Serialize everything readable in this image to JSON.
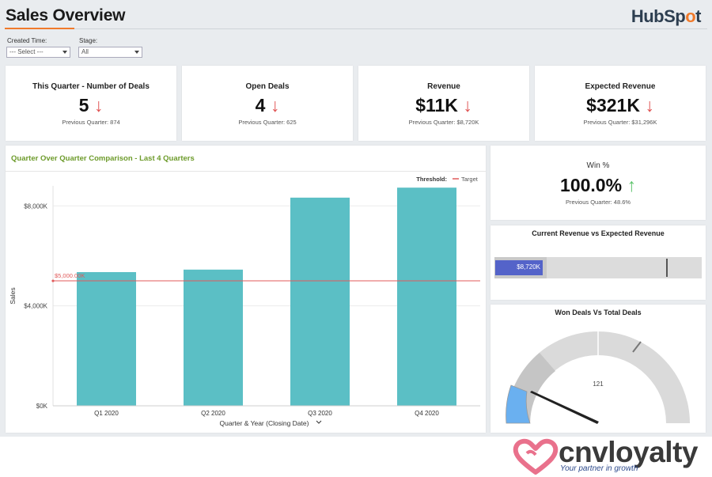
{
  "header": {
    "title": "Sales Overview",
    "brand_logo": "HubSpot",
    "brand_logo_accent": "#f07a2b"
  },
  "filters": {
    "created_time": {
      "label": "Created Time:",
      "value": "--- Select ---"
    },
    "stage": {
      "label": "Stage:",
      "value": "All"
    }
  },
  "kpis": [
    {
      "title": "This Quarter - Number of Deals",
      "value": "5",
      "trend": "down",
      "arrow": "↓",
      "previous": "Previous Quarter: 874"
    },
    {
      "title": "Open Deals",
      "value": "4",
      "trend": "down",
      "arrow": "↓",
      "previous": "Previous Quarter: 625"
    },
    {
      "title": "Revenue",
      "value": "$11K",
      "trend": "down",
      "arrow": "↓",
      "previous": "Previous Quarter: $8,720K"
    },
    {
      "title": "Expected Revenue",
      "value": "$321K",
      "trend": "down",
      "arrow": "↓",
      "previous": "Previous Quarter: $31,296K"
    }
  ],
  "win": {
    "title": "Win %",
    "value": "100.0%",
    "arrow": "↑",
    "previous": "Previous Quarter: 48.6%"
  },
  "revenue_bar": {
    "title": "Current Revenue vs Expected Revenue",
    "label": "$8,720K",
    "fill_fraction": 0.25,
    "target_fraction": 0.83
  },
  "gauge": {
    "title": "Won Deals Vs Total Deals",
    "center_label": "121"
  },
  "chart_data": {
    "type": "bar",
    "title": "Quarter Over Quarter Comparison - Last 4 Quarters",
    "categories": [
      "Q1 2020",
      "Q2 2020",
      "Q3 2020",
      "Q4 2020"
    ],
    "values": [
      5350,
      5450,
      8330,
      8730
    ],
    "xlabel": "Quarter & Year (Closing Date)",
    "ylabel": "Sales",
    "ylim": [
      0,
      8800
    ],
    "yticks": [
      0,
      4000,
      8000
    ],
    "ytick_labels": [
      "$0K",
      "$4,000K",
      "$8,000K"
    ],
    "threshold": {
      "value": 5000,
      "label": "$5,000.00K",
      "legend_title": "Threshold:",
      "legend_label": "Target",
      "color": "#e05a5a"
    },
    "bar_color": "#5bbfc5",
    "grid": true
  },
  "footer_brand": {
    "name": "cnvloyalty",
    "tagline": "Your partner in growth",
    "heart_color": "#e9718c"
  }
}
